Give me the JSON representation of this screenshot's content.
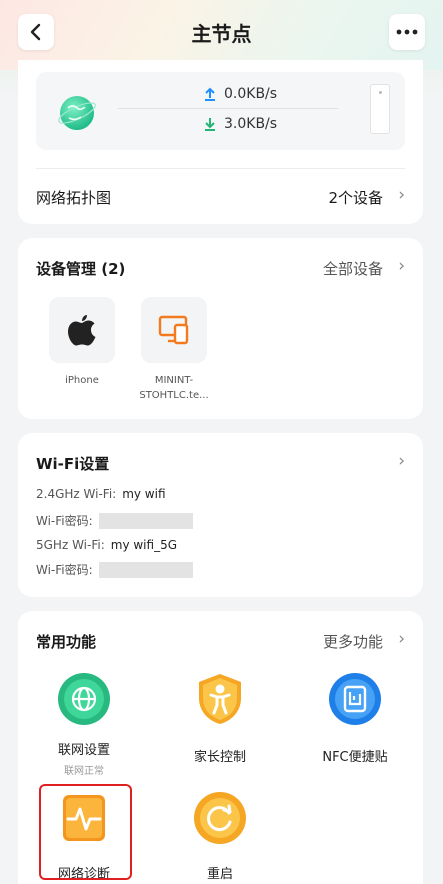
{
  "header": {
    "title": "主节点"
  },
  "speed": {
    "upload": "0.0KB/s",
    "download": "3.0KB/s"
  },
  "topology": {
    "label": "网络拓扑图",
    "value": "2个设备"
  },
  "devices": {
    "title": "设备管理 (2)",
    "all_link": "全部设备",
    "items": [
      {
        "name": "iPhone",
        "icon": "apple-icon"
      },
      {
        "name": "MININT-STOHTLC.te...",
        "icon": "pc-phone-icon"
      }
    ]
  },
  "wifi": {
    "title": "Wi-Fi设置",
    "lines": [
      {
        "label": "2.4GHz Wi-Fi:",
        "value": "my wifi"
      },
      {
        "label": "Wi-Fi密码:",
        "masked": true
      },
      {
        "label": "5GHz Wi-Fi:",
        "value": "my wifi_5G"
      },
      {
        "label": "Wi-Fi密码:",
        "masked": true
      }
    ]
  },
  "features": {
    "title": "常用功能",
    "more_link": "更多功能",
    "items": [
      {
        "label": "联网设置",
        "sub": "联网正常",
        "icon": "globe-icon",
        "color": "#2fbf8a"
      },
      {
        "label": "家长控制",
        "icon": "child-shield-icon",
        "color": "#f5b435"
      },
      {
        "label": "NFC便捷贴",
        "icon": "nfc-icon",
        "color": "#2d8bf0"
      },
      {
        "label": "网络诊断",
        "icon": "diagnosis-icon",
        "color": "#f5a52f"
      },
      {
        "label": "重启",
        "icon": "restart-icon",
        "color": "#f5b435"
      }
    ]
  }
}
